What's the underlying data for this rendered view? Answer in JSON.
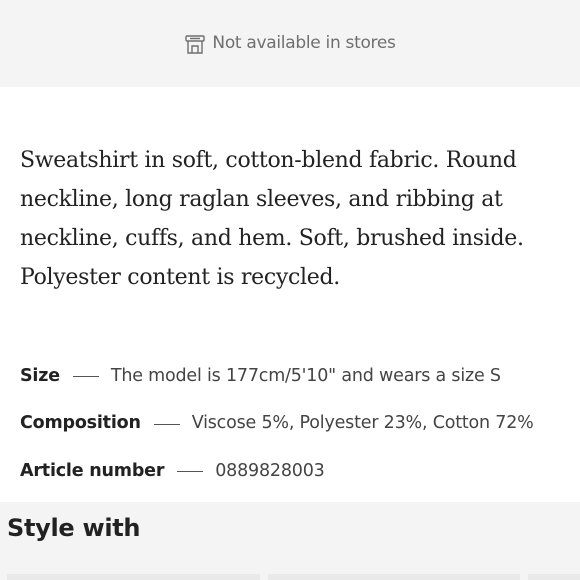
{
  "store_availability": {
    "icon": "store-icon",
    "text": "Not available in stores"
  },
  "description": "Sweatshirt in soft, cotton-blend fabric. Round neckline, long raglan sleeves, and ribbing at neckline, cuffs, and hem. Soft, brushed inside. Polyester content is recycled.",
  "details": [
    {
      "label": "Size",
      "value": "The model is 177cm/5'10\" and wears a size S"
    },
    {
      "label": "Composition",
      "value": "Viscose 5%, Polyester 23%, Cotton 72%"
    },
    {
      "label": "Article number",
      "value": "0889828003"
    }
  ],
  "style_with": {
    "title": "Style with"
  },
  "colors": {
    "band_background": "#f4f4f4",
    "text_primary": "#222222",
    "text_muted": "#6f6f6f"
  }
}
